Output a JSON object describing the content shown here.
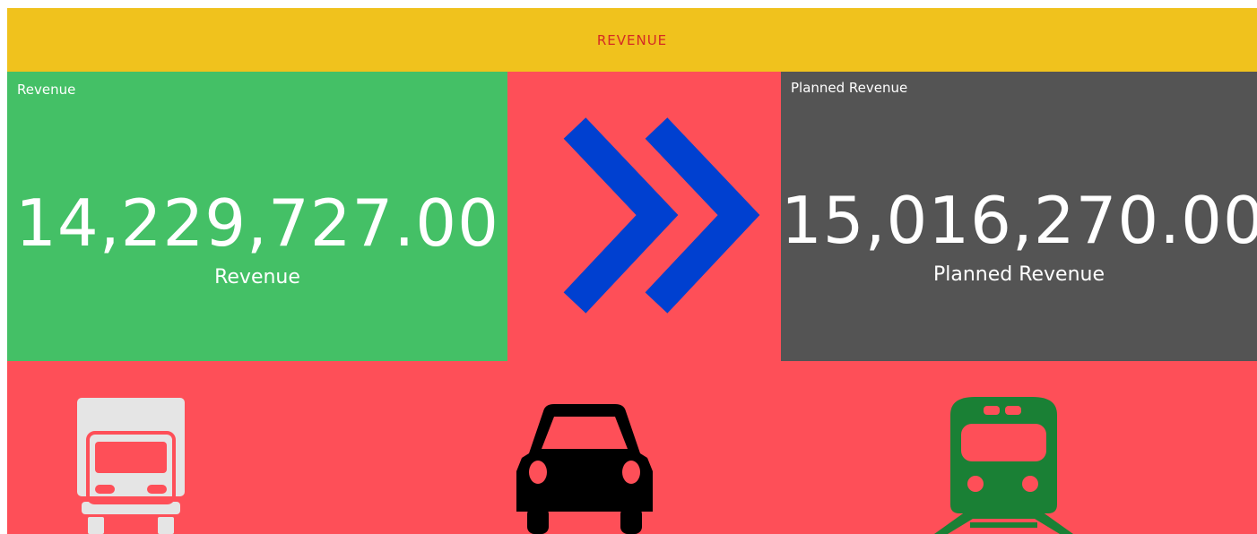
{
  "header": {
    "title": "REVENUE",
    "background": "#f0c21d",
    "text_color": "#d42a25"
  },
  "revenue_tile": {
    "label": "Revenue",
    "value": "14,229,727.00",
    "sub_label": "Revenue",
    "background": "#44c066"
  },
  "indicator": {
    "icon": "double-chevron-right-icon",
    "color": "#0040d0"
  },
  "planned_tile": {
    "label": "Planned Revenue",
    "value": "15,016,270.00",
    "sub_label": "Planned Revenue",
    "background": "#545454"
  },
  "panel_background": "#fe4f58",
  "transport_icons": [
    {
      "icon": "truck-icon",
      "color": "#e5e5e5"
    },
    {
      "icon": "car-icon",
      "color": "#000000"
    },
    {
      "icon": "train-icon",
      "color": "#1a8035"
    }
  ]
}
